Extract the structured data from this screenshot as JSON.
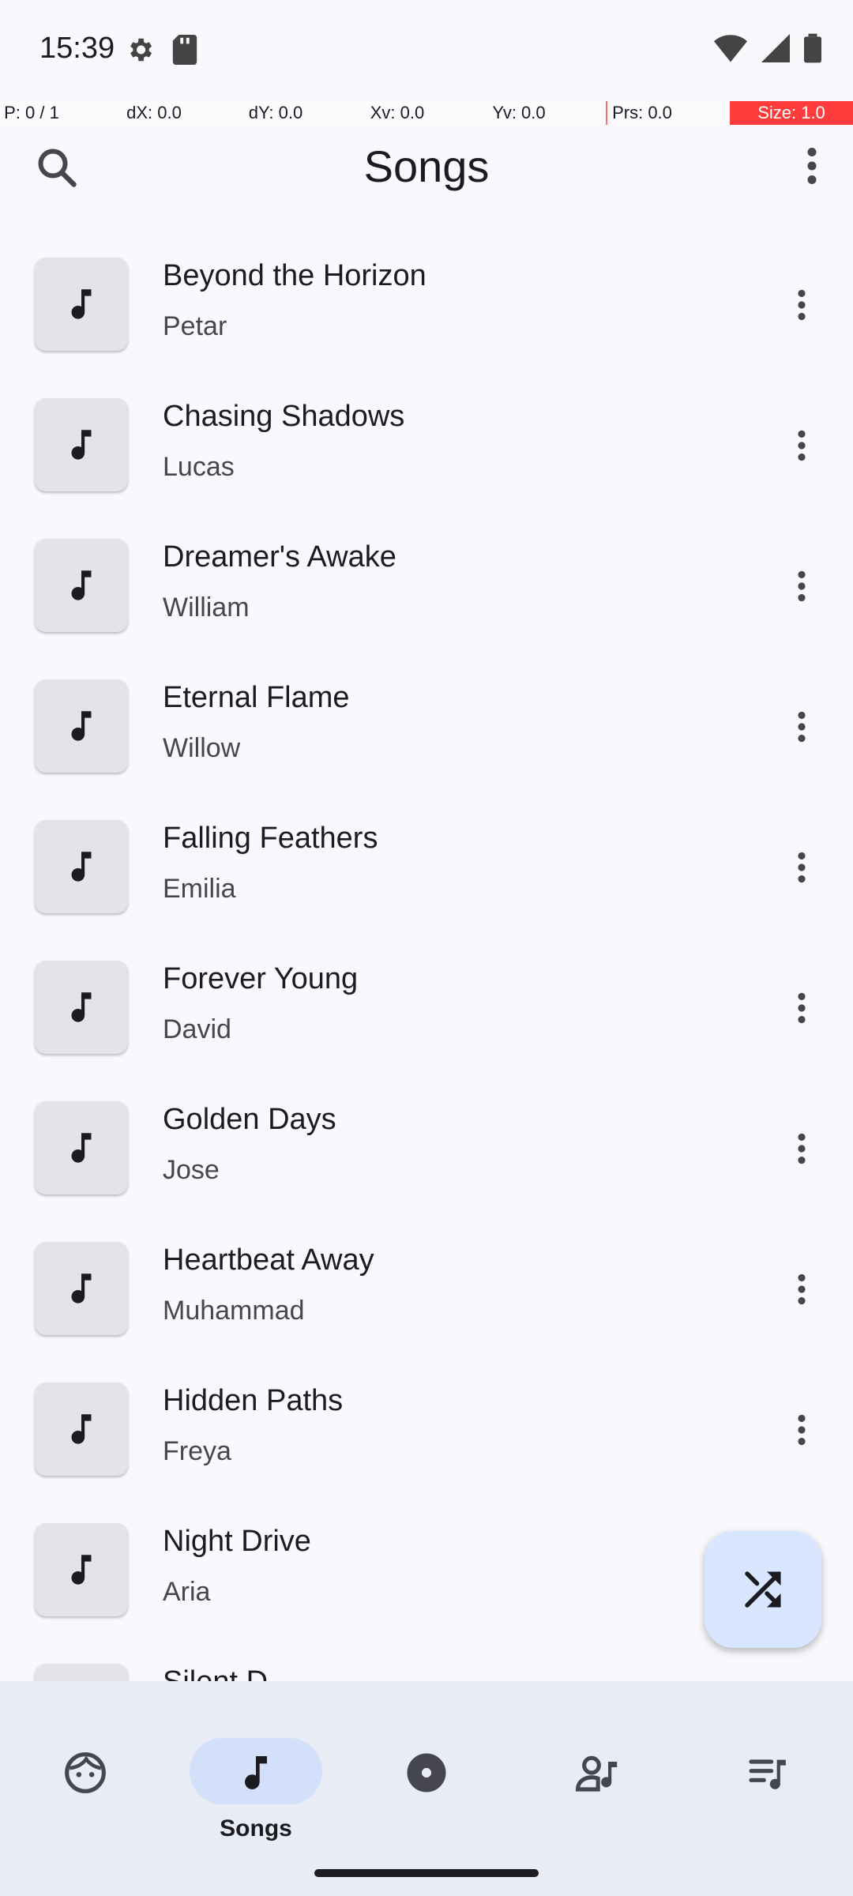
{
  "status": {
    "time": "15:39"
  },
  "debug": {
    "p": "P: 0 / 1",
    "dx": "dX: 0.0",
    "dy": "dY: 0.0",
    "xv": "Xv: 0.0",
    "yv": "Yv: 0.0",
    "prs": "Prs: 0.0",
    "size": "Size: 1.0"
  },
  "header": {
    "title": "Songs",
    "search_icon": "search-icon",
    "more_icon": "more-vert-icon"
  },
  "songs": [
    {
      "title": "Beyond the Horizon",
      "artist": "Petar"
    },
    {
      "title": "Chasing Shadows",
      "artist": "Lucas"
    },
    {
      "title": "Dreamer's Awake",
      "artist": "William"
    },
    {
      "title": "Eternal Flame",
      "artist": "Willow"
    },
    {
      "title": "Falling Feathers",
      "artist": "Emilia"
    },
    {
      "title": "Forever Young",
      "artist": "David"
    },
    {
      "title": "Golden Days",
      "artist": "Jose"
    },
    {
      "title": "Heartbeat Away",
      "artist": "Muhammad"
    },
    {
      "title": "Hidden Paths",
      "artist": "Freya"
    },
    {
      "title": "Night Drive",
      "artist": "Aria"
    },
    {
      "title": "Silent D",
      "artist": ""
    }
  ],
  "fab": {
    "icon": "shuffle-icon"
  },
  "nav": {
    "items": [
      {
        "icon": "face-icon",
        "label": ""
      },
      {
        "icon": "music-note-icon",
        "label": "Songs",
        "active": true
      },
      {
        "icon": "album-icon",
        "label": ""
      },
      {
        "icon": "artist-icon",
        "label": ""
      },
      {
        "icon": "playlist-icon",
        "label": ""
      }
    ]
  },
  "colors": {
    "accent_container": "#D3E0FA",
    "fab_bg": "#D8E6FF",
    "background": "#F9F9FD",
    "nav_bg": "#E8ECF4"
  }
}
